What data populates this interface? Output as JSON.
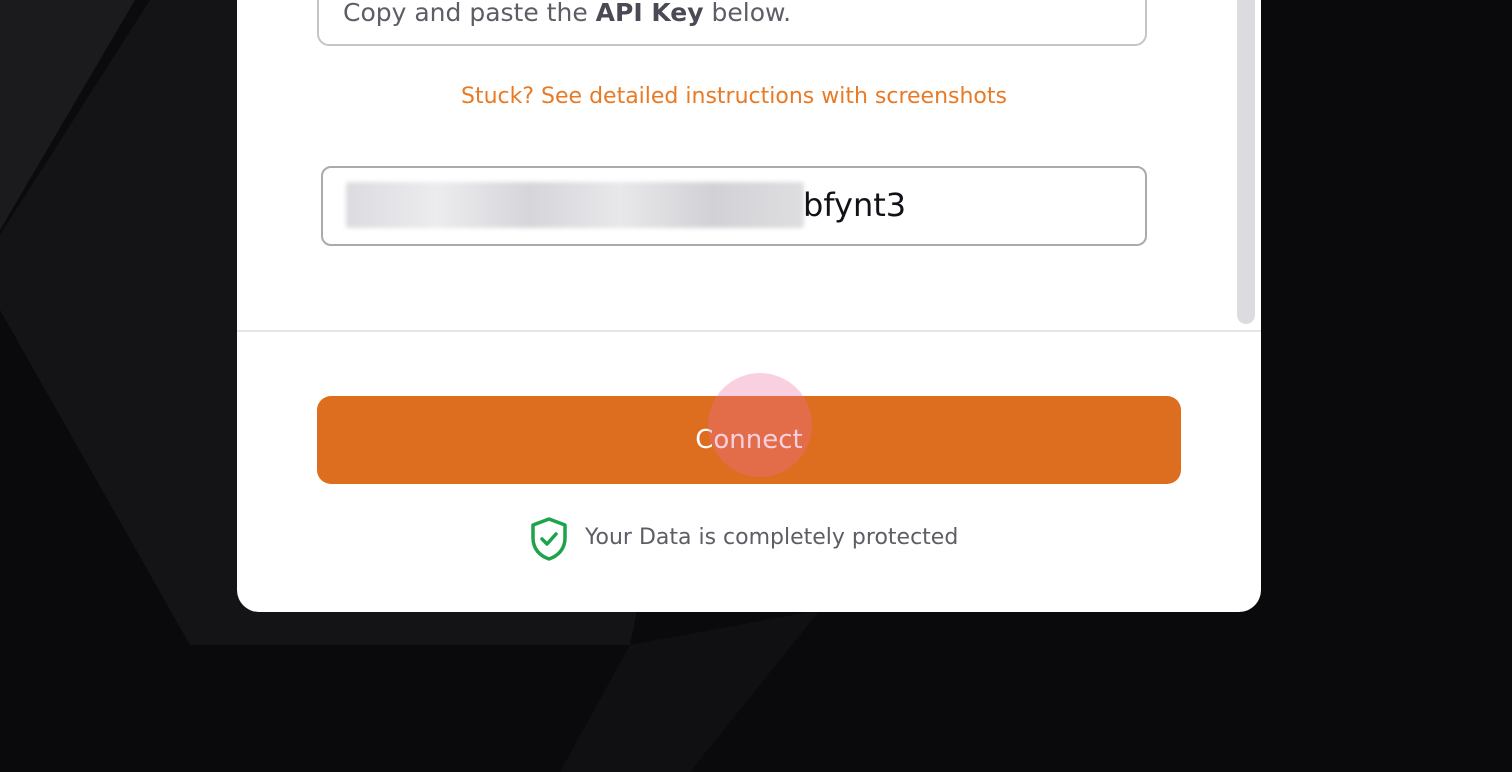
{
  "instructions": {
    "step_prefix": "Copy and paste the ",
    "step_emphasis": "API Key",
    "step_suffix": " below."
  },
  "help_link": {
    "label": "Stuck? See detailed instructions with screenshots"
  },
  "api_key_field": {
    "visible_suffix": "bfynt3"
  },
  "actions": {
    "connect_label": "Connect"
  },
  "security_note": {
    "text": "Your Data is completely protected",
    "icon": "shield-check-icon"
  },
  "colors": {
    "accent": "#dd6e1f",
    "link": "#e87a26",
    "shield": "#1fa34a",
    "background": "#0b0b0d"
  }
}
